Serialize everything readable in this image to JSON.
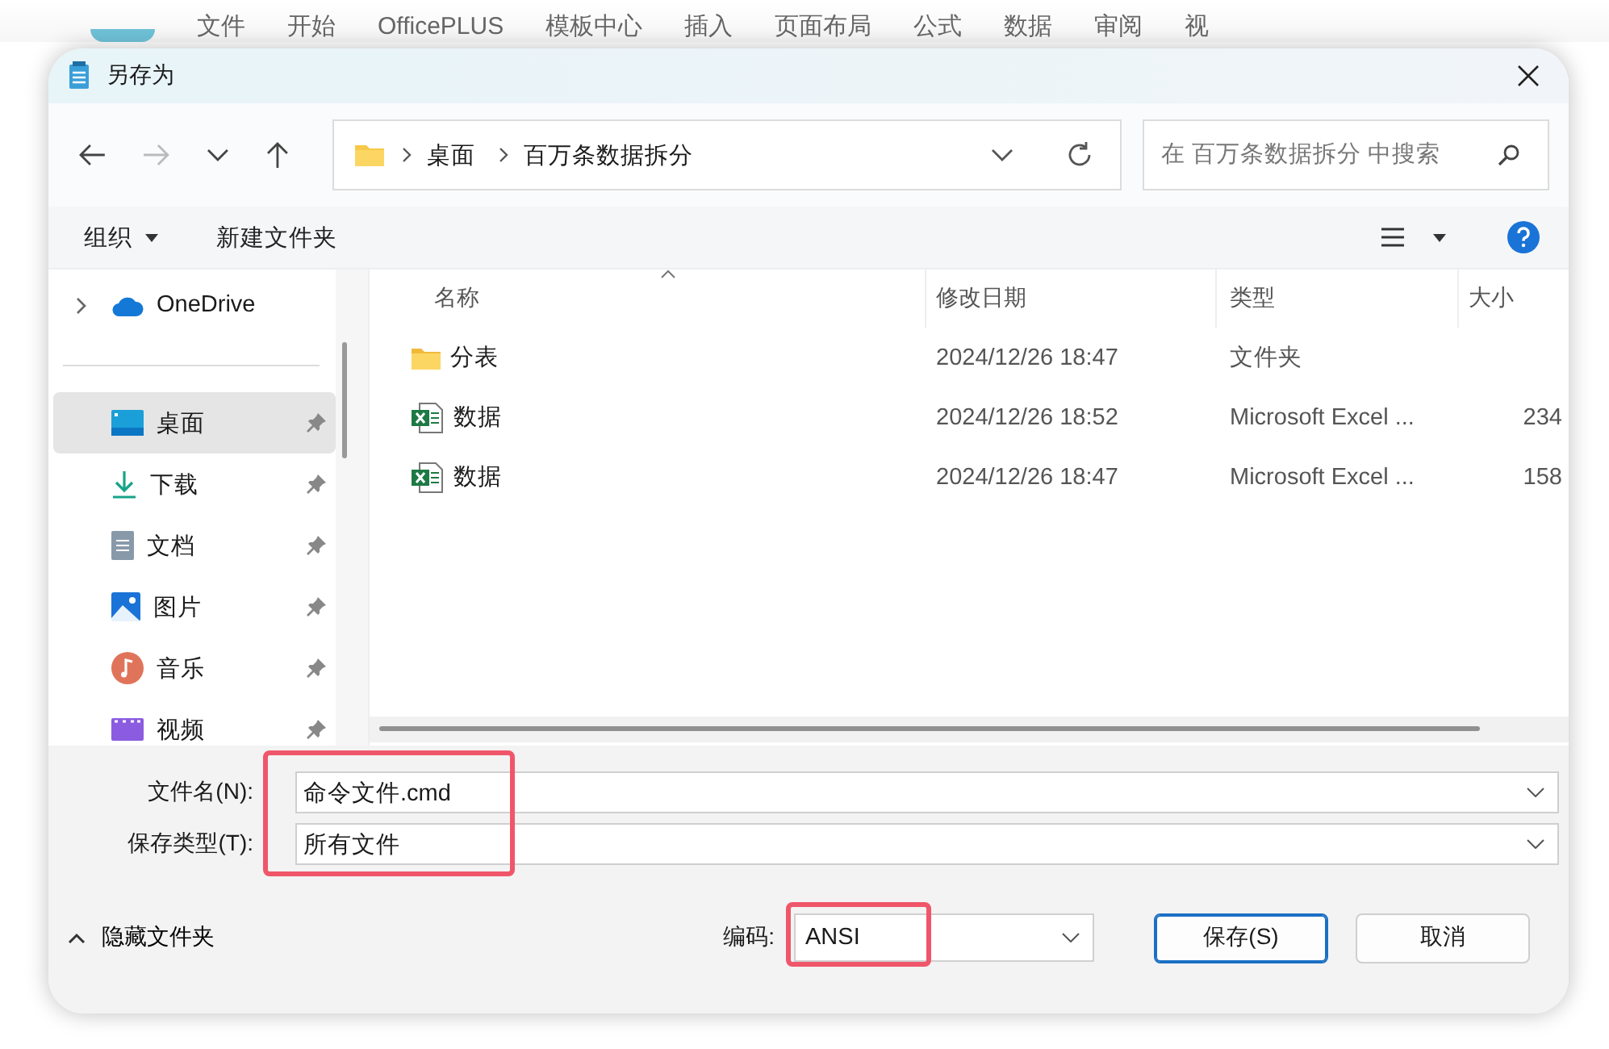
{
  "background_app": {
    "ribbon_tabs": [
      "文件",
      "开始",
      "OfficePLUS",
      "模板中心",
      "插入",
      "页面布局",
      "公式",
      "数据",
      "审阅",
      "视"
    ]
  },
  "window": {
    "title": "另存为"
  },
  "nav": {
    "back": {
      "disabled": false
    },
    "forward": {
      "disabled": true
    }
  },
  "address": {
    "path": [
      "桌面",
      "百万条数据拆分"
    ]
  },
  "search": {
    "placeholder": "在 百万条数据拆分 中搜索"
  },
  "toolbar": {
    "organize": "组织",
    "new_folder": "新建文件夹"
  },
  "sidebar": {
    "items": [
      {
        "label": "OneDrive",
        "expanded": false,
        "pinned": false,
        "selected": false
      },
      {
        "label": "桌面",
        "pinned": true,
        "selected": true
      },
      {
        "label": "下载",
        "pinned": true,
        "selected": false
      },
      {
        "label": "文档",
        "pinned": true,
        "selected": false
      },
      {
        "label": "图片",
        "pinned": true,
        "selected": false
      },
      {
        "label": "音乐",
        "pinned": true,
        "selected": false
      },
      {
        "label": "视频",
        "pinned": true,
        "selected": false
      }
    ]
  },
  "table": {
    "columns": [
      {
        "label": "名称",
        "sorted": true
      },
      {
        "label": "修改日期",
        "sorted": false
      },
      {
        "label": "类型",
        "sorted": false
      },
      {
        "label": "大小",
        "sorted": false
      }
    ],
    "rows": [
      {
        "kind": "folder",
        "name": "分表",
        "modified": "2024/12/26 18:47",
        "type": "文件夹"
      },
      {
        "kind": "excel",
        "name": "数据",
        "modified": "2024/12/26 18:52",
        "type": "Microsoft Excel ...",
        "size": "234"
      },
      {
        "kind": "excel",
        "name": "数据",
        "modified": "2024/12/26 18:47",
        "type": "Microsoft Excel ...",
        "size": "158"
      }
    ]
  },
  "form": {
    "highlighted": true,
    "file_name": {
      "label": "文件名(N):",
      "value": "命令文件.cmd"
    },
    "file_type": {
      "label": "保存类型(T):",
      "value": "所有文件"
    }
  },
  "footer": {
    "hide_folders": "隐藏文件夹",
    "encoding": {
      "label": "编码:",
      "value": "ANSI",
      "highlighted": true
    },
    "buttons": [
      {
        "label": "保存(S)",
        "primary": true
      },
      {
        "label": "取消",
        "primary": false
      }
    ]
  }
}
